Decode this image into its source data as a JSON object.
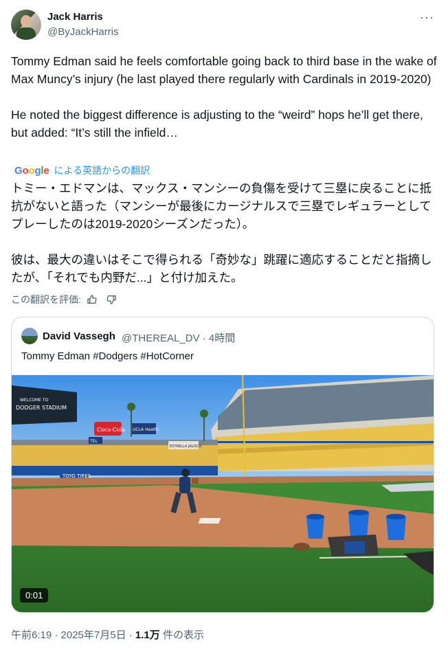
{
  "author": {
    "name": "Jack Harris",
    "handle": "@ByJackHarris"
  },
  "tweet": {
    "text": "Tommy Edman said he feels comfortable going back to third base in the wake of Max Muncy’s injury (he last played there regularly with Cardinals in 2019-2020)\n\nHe noted the biggest difference is adjusting to the “weird” hops he’ll get there, but added: “It’s still the infield…",
    "translation_label": "による英語からの翻訳",
    "translated_text": "トミー・エドマンは、マックス・マンシーの負傷を受けて三塁に戻ることに抵抗がないと語った（マンシーが最後にカージナルスで三塁でレギュラーとしてプレーしたのは2019-2020シーズンだった）。\n\n彼は、最大の違いはそこで得られる「奇妙な」跳躍に適応することだと指摘したが、「それでも内野だ...」と付け加えた。",
    "rate_label": "この翻訳を評価:",
    "google_logo": "Google"
  },
  "quote": {
    "name": "David Vassegh",
    "handle_time": "@THEREAL_DV · 4時間",
    "text": "Tommy Edman #Dodgers #HotCorner",
    "video_duration": "0:01",
    "scene_signs": {
      "welcome": "WELCOME TO",
      "stadium": "DODGER STADIUM",
      "coke": "Coca-Cola",
      "ucla": "UCLA Health",
      "tel": "TEL",
      "estrella": "ESTRELLA JALISCO",
      "toyo": "TOYO TIRES"
    }
  },
  "footer": {
    "time_date": "午前6:19 · 2025年7月5日 · ",
    "views": "1.1万",
    "views_label": " 件の表示"
  },
  "icons": {
    "more": "more-icon",
    "thumbs_up": "thumbs-up-icon",
    "thumbs_down": "thumbs-down-icon"
  }
}
